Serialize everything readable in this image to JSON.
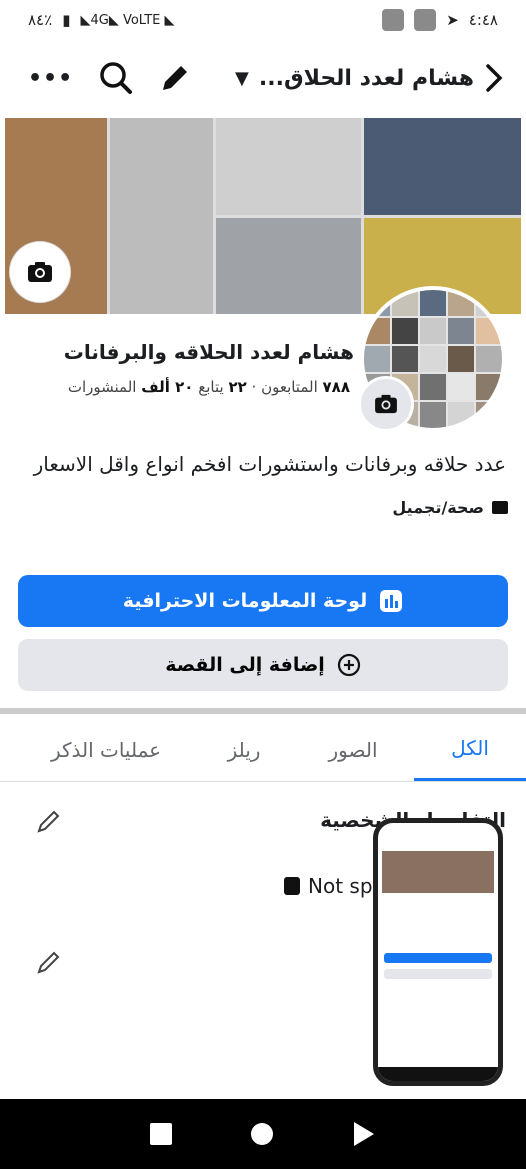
{
  "status": {
    "battery": "٨٤٪",
    "network1": "4G",
    "network2": "VoLTE",
    "time": "٤:٤٨"
  },
  "topbar": {
    "title": "هشام لعدد الحلاق..."
  },
  "profile": {
    "name": "هشام لعدد الحلاقه والبرفانات",
    "followers_count": "٧٨٨",
    "followers_label": "المتابعون",
    "following_count": "٢٢",
    "following_label": "يتابع",
    "posts_count": "٢٠ ألف",
    "posts_label": "المنشورات",
    "bio": "عدد حلاقه وبرفانات واستشورات افخم انواع واقل الاسعار",
    "category": "صحة/تجميل"
  },
  "buttons": {
    "professional_dashboard": "لوحة المعلومات الاحترافية",
    "add_to_story": "إضافة إلى القصة"
  },
  "tabs": [
    {
      "label": "الكل"
    },
    {
      "label": "الصور"
    },
    {
      "label": "ريلز"
    },
    {
      "label": "عمليات الذكر"
    }
  ],
  "details": {
    "title": "التفاصيل الشخصية",
    "not_specified": "Not sp"
  },
  "colors": {
    "accent": "#1877f2",
    "secondary_button": "#e4e6eb"
  }
}
